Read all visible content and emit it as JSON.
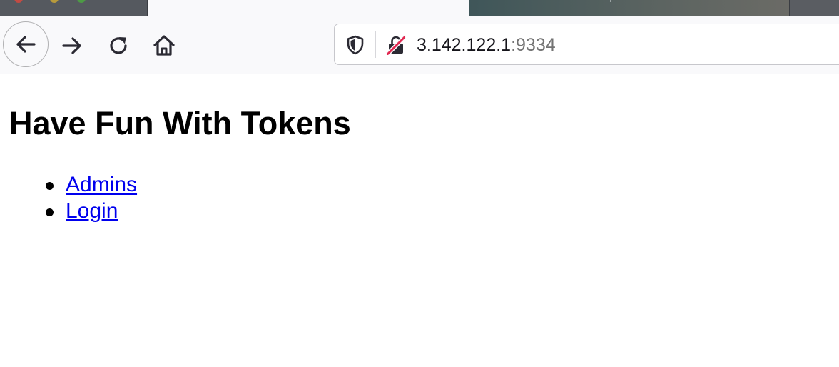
{
  "browser": {
    "address_bar": {
      "host": "3.142.122.1",
      "port": ":9334"
    }
  },
  "page": {
    "title": "Have Fun With Tokens",
    "links": [
      {
        "label": "Admins"
      },
      {
        "label": "Login"
      }
    ],
    "link_color": "#0000ee"
  },
  "icons": {
    "back": "arrow-left-icon",
    "forward": "arrow-right-icon",
    "reload": "reload-icon",
    "home": "home-icon",
    "tracking_protection": "shield-icon",
    "connection": "insecure-lock-icon"
  }
}
